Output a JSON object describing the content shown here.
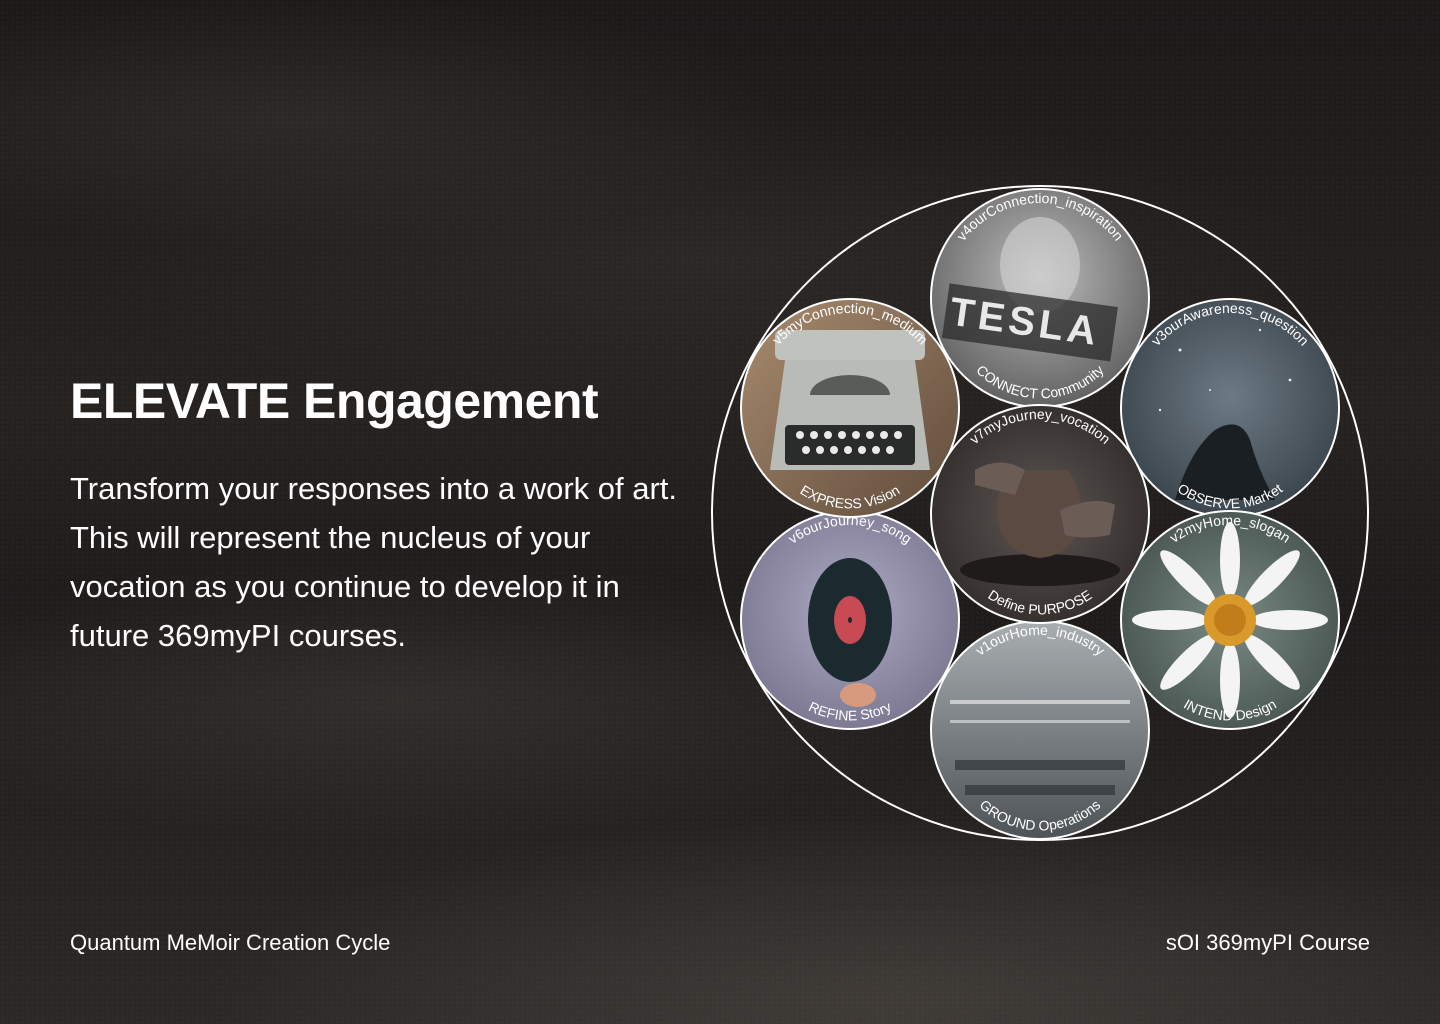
{
  "heading": "ELEVATE Engagement",
  "description": "Transform your responses into a work of art. This will represent the nucleus of your vocation as you continue to develop it in future 369myPI courses.",
  "footer": {
    "left": "Quantum MeMoir Creation Cycle",
    "right": "sOI 369myPI Course"
  },
  "circles": [
    {
      "id": "connect",
      "top_label": "v4ourConnection_inspiration",
      "bottom_label": "CONNECT Community",
      "image": "tesla-portrait-icon",
      "color": "#8a8a8a"
    },
    {
      "id": "observe",
      "top_label": "v3ourAwareness_question",
      "bottom_label": "OBSERVE Market",
      "image": "starry-sky-icon",
      "color": "#4b565e"
    },
    {
      "id": "intend",
      "top_label": "v2myHome_slogan",
      "bottom_label": "INTEND Design",
      "image": "daisy-flower-icon",
      "color": "#55625e"
    },
    {
      "id": "ground",
      "top_label": "v1ourHome_industry",
      "bottom_label": "GROUND Operations",
      "image": "office-workspace-icon",
      "color": "#6e7478"
    },
    {
      "id": "refine",
      "top_label": "v6ourJourney_song",
      "bottom_label": "REFINE Story",
      "image": "vinyl-record-icon",
      "color": "#8f8ca6"
    },
    {
      "id": "express",
      "top_label": "v5myConnection_medium",
      "bottom_label": "EXPRESS Vision",
      "image": "typewriter-icon",
      "color": "#8a6e57"
    },
    {
      "id": "purpose",
      "top_label": "v7myJourney_vocation",
      "bottom_label": "Define PURPOSE",
      "image": "pottery-hands-icon",
      "color": "#3f3a38"
    }
  ]
}
